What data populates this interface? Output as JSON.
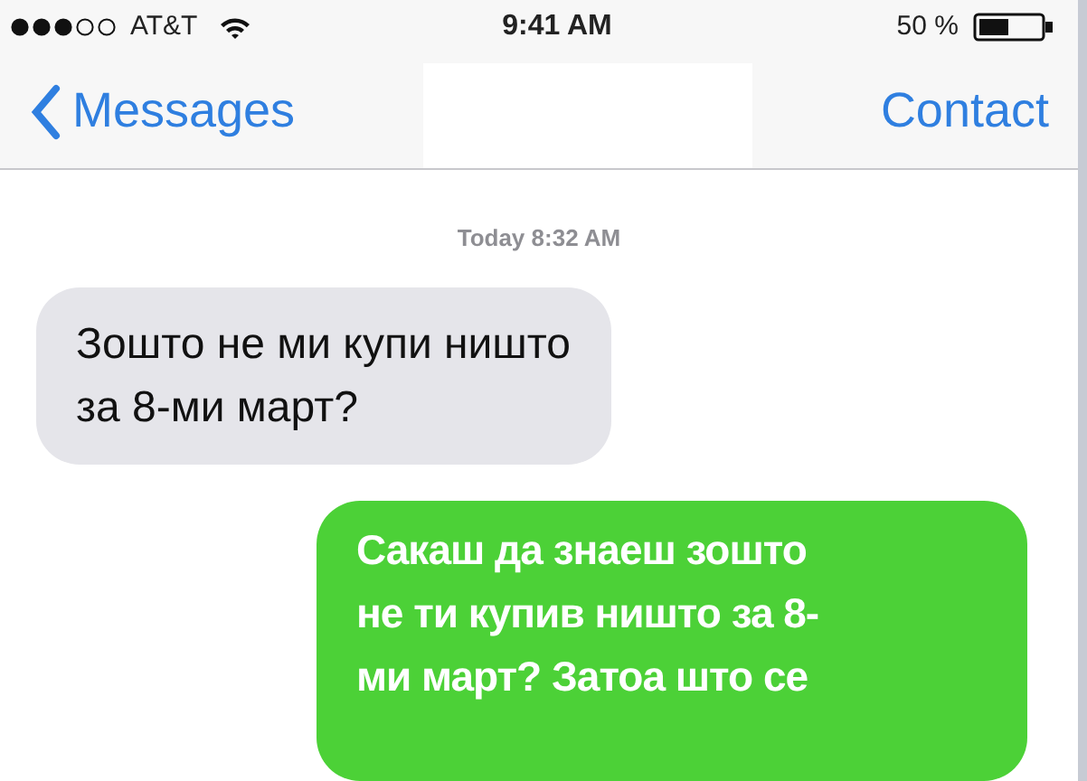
{
  "status_bar": {
    "carrier": "AT&T",
    "time": "9:41 AM",
    "battery": "50 %"
  },
  "nav_bar": {
    "back": "Messages",
    "action": "Contact"
  },
  "timestamp": "Today 8:32 AM",
  "messages": [
    {
      "kind": "received",
      "lines": [
        "Зошто не ми купи ништо",
        "за 8-ми март?"
      ]
    },
    {
      "kind": "sent",
      "lines": [
        "Сакаш да знаеш зошто",
        "не ти купив ништо за 8-",
        "ми март? Затоа што се"
      ]
    }
  ]
}
